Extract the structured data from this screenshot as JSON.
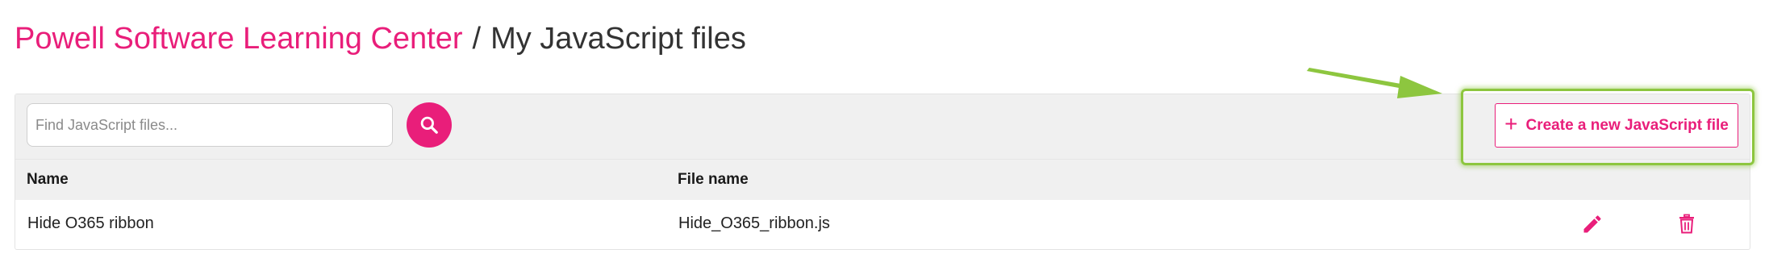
{
  "breadcrumb": {
    "parent_label": "Powell Software Learning Center",
    "separator": "/",
    "current_label": "My JavaScript files"
  },
  "search": {
    "value": "",
    "placeholder": "Find JavaScript files...",
    "icon": "search-icon"
  },
  "toolbar": {
    "create_label": "Create a new JavaScript file",
    "create_icon": "plus-icon",
    "create_icon_glyph": "+"
  },
  "table": {
    "columns": [
      "Name",
      "File name"
    ],
    "rows": [
      {
        "name": "Hide O365 ribbon",
        "file_name": "Hide_O365_ribbon.js",
        "actions": [
          "pencil-icon",
          "trash-icon"
        ]
      }
    ]
  },
  "annotation": {
    "arrow_color": "#8dc63f",
    "highlight_color": "#8dc63f"
  },
  "colors": {
    "accent": "#e91e7a",
    "toolbar_background": "#f0f0f0",
    "text": "#222222"
  }
}
